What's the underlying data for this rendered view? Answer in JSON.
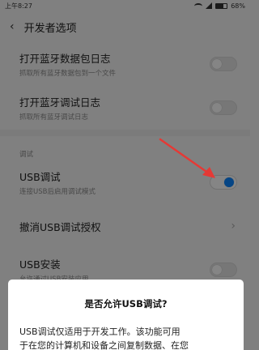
{
  "statusbar": {
    "time": "上午8:27",
    "battery": "68%"
  },
  "header": {
    "back_icon": "‹",
    "title": "开发者选项"
  },
  "items": [
    {
      "title": "打开蓝牙数据包日志",
      "desc": "抓取所有蓝牙数据包到一个文件",
      "toggle": false
    },
    {
      "title": "打开蓝牙调试日志",
      "desc": "抓取所有蓝牙调试日志",
      "toggle": false
    }
  ],
  "section": {
    "label": "调试"
  },
  "debug_items": {
    "usb_debug": {
      "title": "USB调试",
      "desc": "连接USB后启用调试模式",
      "toggle": true
    },
    "revoke": {
      "title": "撤消USB调试授权",
      "chevron": "›"
    },
    "usb_install": {
      "title": "USB安装",
      "desc": "允许通过USB安装应用",
      "toggle": false
    }
  },
  "dialog": {
    "title": "是否允许USB调试?",
    "body_line1": "USB调试仅适用于开发工作。该功能可用",
    "body_line2": "于在您的计算机和设备之间复制数据、在您"
  },
  "colors": {
    "accent": "#0a84ff",
    "arrow": "#e53935"
  }
}
